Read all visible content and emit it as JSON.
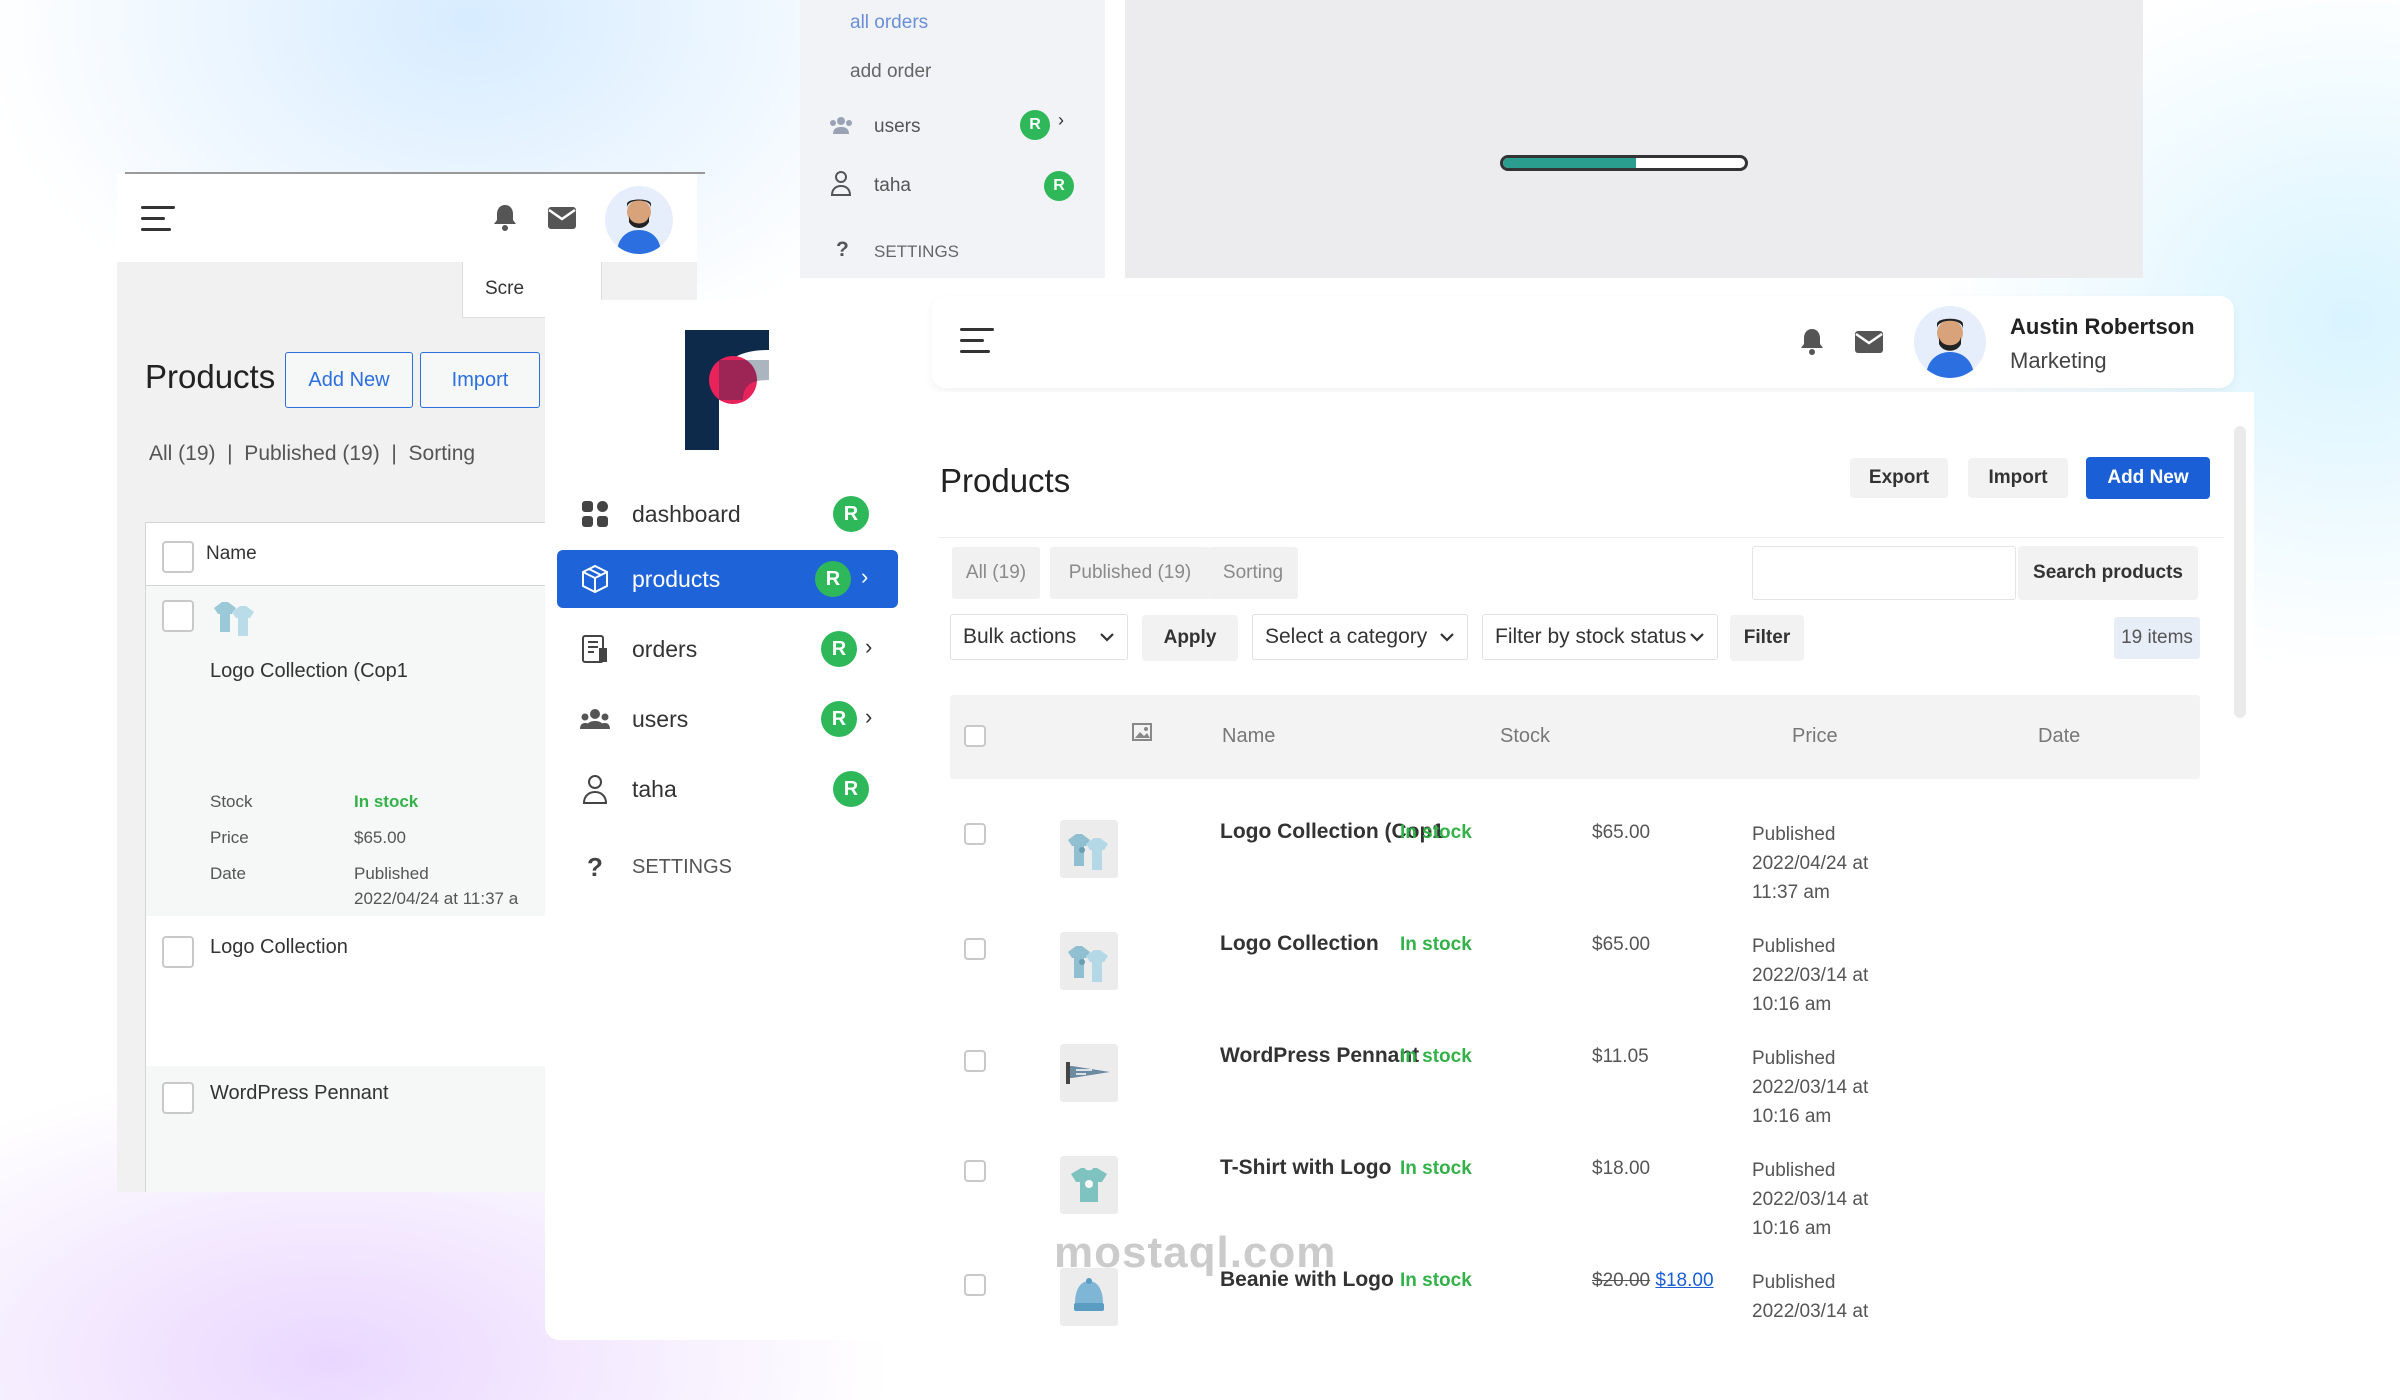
{
  "bg_top_sidebar": {
    "items": [
      {
        "label": "all orders"
      },
      {
        "label": "add order"
      },
      {
        "label": "users",
        "badge": "R"
      },
      {
        "label": "taha",
        "badge": "R"
      },
      {
        "label": "SETTINGS"
      }
    ]
  },
  "bg_progress": {
    "fraction": 0.55
  },
  "bg_left": {
    "screen_options": "Scre",
    "title": "Products",
    "add_new": "Add New",
    "import": "Import",
    "filters": "All (19)  |  Published (19)  |  Sorting",
    "name_col": "Name",
    "card": {
      "name": "Logo Collection (Cop1",
      "stock_label": "Stock",
      "stock_value": "In stock",
      "price_label": "Price",
      "price_value": "$65.00",
      "date_label": "Date",
      "date_status": "Published",
      "date_value": "2022/04/24 at 11:37 a"
    },
    "rows": [
      {
        "name": "Logo Collection"
      },
      {
        "name": "WordPress Pennant"
      }
    ]
  },
  "sidebar": {
    "items": [
      {
        "label": "dashboard",
        "badge": "R"
      },
      {
        "label": "products",
        "badge": "R"
      },
      {
        "label": "orders",
        "badge": "R"
      },
      {
        "label": "users",
        "badge": "R"
      },
      {
        "label": "taha",
        "badge": "R"
      },
      {
        "label": "SETTINGS"
      }
    ]
  },
  "header": {
    "user_name": "Austin Robertson",
    "user_role": "Marketing"
  },
  "main": {
    "title": "Products",
    "export": "Export",
    "import": "Import",
    "add_new": "Add New",
    "tabs": [
      {
        "label": "All (19)"
      },
      {
        "label": "Published (19)"
      },
      {
        "label": "Sorting"
      }
    ],
    "search_button": "Search products",
    "search_placeholder": "",
    "bulk_actions": "Bulk actions",
    "apply": "Apply",
    "category": "Select a category",
    "stock_filter": "Filter by stock status",
    "filter": "Filter",
    "count": "19 items",
    "columns": {
      "name": "Name",
      "stock": "Stock",
      "price": "Price",
      "date": "Date"
    },
    "rows": [
      {
        "name": "Logo Collection (Cop1",
        "stock": "In stock",
        "price": "$65.00",
        "date1": "Published",
        "date2": "2022/04/24 at",
        "date3": "11:37 am"
      },
      {
        "name": "Logo Collection",
        "stock": "In stock",
        "price": "$65.00",
        "date1": "Published",
        "date2": "2022/03/14 at",
        "date3": "10:16 am"
      },
      {
        "name": "WordPress Pennant",
        "stock": "In stock",
        "price": "$11.05",
        "date1": "Published",
        "date2": "2022/03/14 at",
        "date3": "10:16 am"
      },
      {
        "name": "T-Shirt with Logo",
        "stock": "In stock",
        "price": "$18.00",
        "date1": "Published",
        "date2": "2022/03/14 at",
        "date3": "10:16 am"
      },
      {
        "name": "Beanie with Logo",
        "stock": "In stock",
        "price_old": "$20.00",
        "price": "$18.00",
        "date1": "Published",
        "date2": "2022/03/14 at",
        "date3": ""
      }
    ]
  },
  "watermark": "mostaql.com"
}
